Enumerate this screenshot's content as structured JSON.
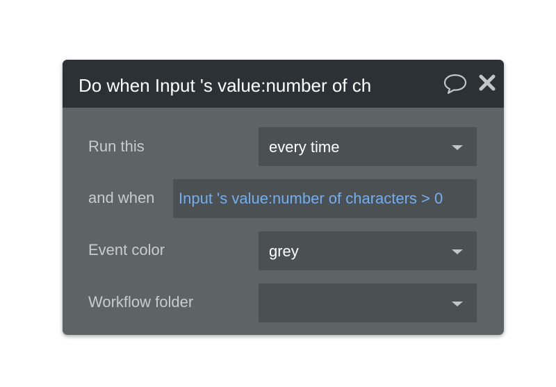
{
  "header": {
    "title": "Do when Input 's value:number of ch",
    "comment_icon": "speech-bubble-icon",
    "close_icon": "close-x-icon"
  },
  "rows": {
    "run_this": {
      "label": "Run this",
      "value": "every time"
    },
    "and_when": {
      "label": "and when",
      "value": "Input 's value:number of characters > 0"
    },
    "event_color": {
      "label": "Event color",
      "value": "grey"
    },
    "workflow_folder": {
      "label": "Workflow folder",
      "value": ""
    }
  },
  "colors": {
    "header_bg": "#2b3134",
    "panel_bg": "#5e6366",
    "field_bg": "#4b5053",
    "condition_text": "#73aef0"
  }
}
